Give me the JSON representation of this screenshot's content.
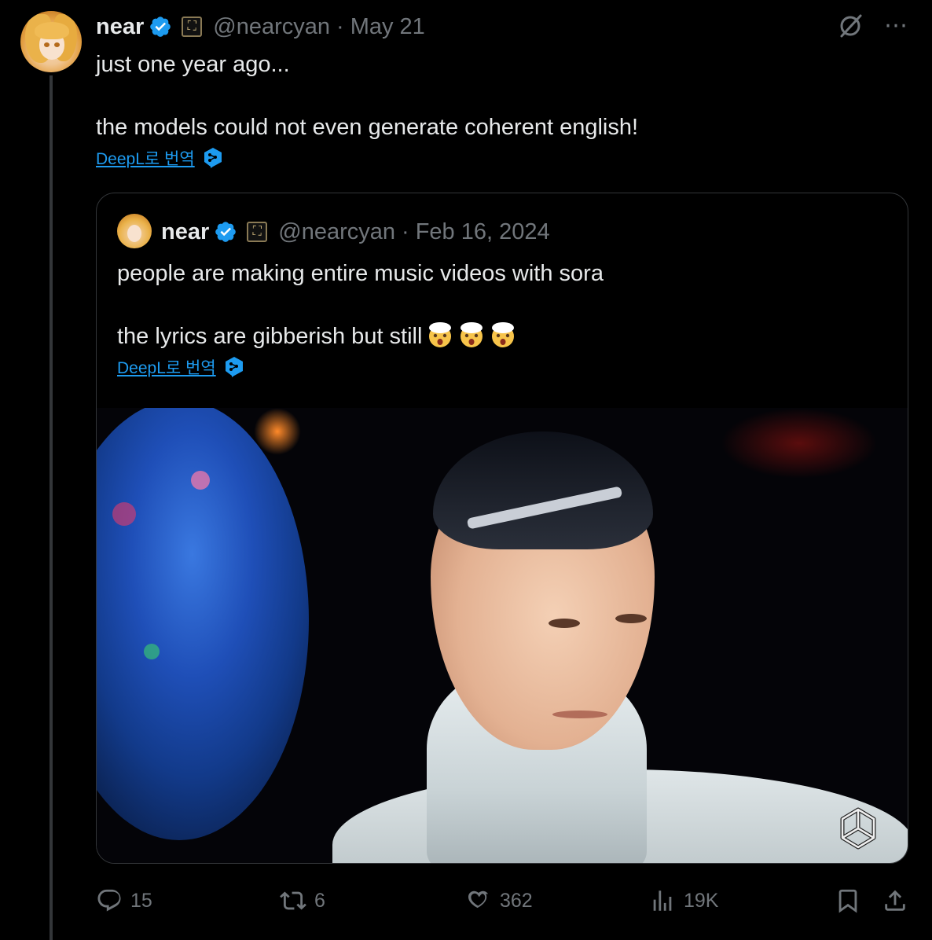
{
  "tweet": {
    "author_name": "near",
    "handle": "@nearcyan",
    "separator": "·",
    "date": "May 21",
    "text_line1": "just one year ago...",
    "text_line2": "the models could not even generate coherent english!",
    "translate_label": "DeepL로 번역"
  },
  "quote": {
    "author_name": "near",
    "handle": "@nearcyan",
    "separator": "·",
    "date": "Feb 16, 2024",
    "text_line1": "people are making entire music videos with sora",
    "text_line2": "the lyrics are gibberish but still",
    "emoji_count": 3,
    "translate_label": "DeepL로 번역"
  },
  "actions": {
    "replies": "15",
    "reposts": "6",
    "likes": "362",
    "views": "19K"
  },
  "icons": {
    "more": "⋯",
    "affiliate_badge": "⛶"
  },
  "colors": {
    "background": "#000000",
    "text": "#e7e9ea",
    "muted": "#71767b",
    "link": "#1d9bf0",
    "verified": "#1d9bf0",
    "border": "#333639"
  }
}
